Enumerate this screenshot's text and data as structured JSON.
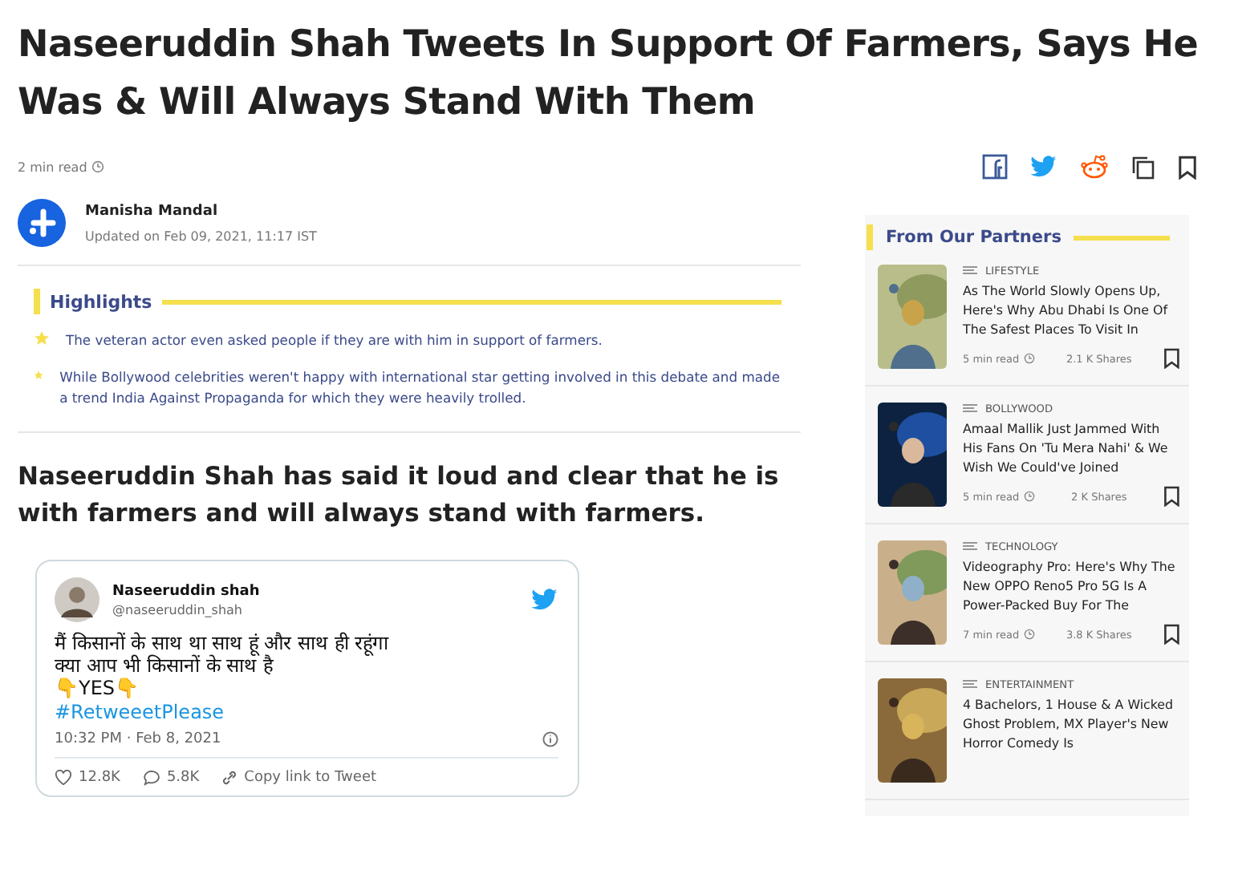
{
  "headline": "Naseeruddin Shah Tweets In Support Of Farmers, Says He Was & Will Always Stand With Them",
  "read_time": "2 min read",
  "share_icons": [
    {
      "kind": "facebook"
    },
    {
      "kind": "twitter"
    },
    {
      "kind": "reddit"
    },
    {
      "kind": "copy"
    },
    {
      "kind": "bookmark"
    }
  ],
  "author": {
    "name": "Manisha Mandal",
    "updated": "Updated on Feb 09, 2021, 11:17 IST"
  },
  "highlights": {
    "title": "Highlights",
    "items": [
      "The veteran actor even asked people if they are with him in support of farmers.",
      "While Bollywood celebrities weren't happy with international star getting involved in this debate and made a trend India Against Propaganda for which they were heavily trolled."
    ]
  },
  "subheading": "Naseeruddin Shah has said it loud and clear that he is with farmers and will always stand with farmers.",
  "tweet": {
    "name": "Naseeruddin shah",
    "handle": "@naseeruddin_shah",
    "lines": [
      "मैं किसानों के साथ था साथ हूं और साथ ही रहूंगा",
      "क्या आप भी किसानों के साथ है",
      "👇YES👇"
    ],
    "hashtag": "#RetweeetPlease",
    "time": "10:32 PM · Feb 8, 2021",
    "likes": "12.8K",
    "replies": "5.8K",
    "copy_link": "Copy link to Tweet"
  },
  "partners": {
    "title": "From Our Partners",
    "cards": [
      {
        "category": "LIFESTYLE",
        "title": "As The World Slowly Opens Up, Here's Why Abu Dhabi Is One Of The Safest Places To Visit In",
        "read": "5 min read",
        "shares": "2.1 K Shares",
        "kind": "picture"
      },
      {
        "category": "BOLLYWOOD",
        "title": "Amaal Mallik Just Jammed With His Fans On 'Tu Mera Nahi' & We Wish We Could've Joined",
        "read": "5 min read",
        "shares": "2 K Shares",
        "kind": "picture"
      },
      {
        "category": "TECHNOLOGY",
        "title": "Videography Pro: Here's Why The New OPPO Reno5 Pro 5G Is A Power-Packed Buy For The",
        "read": "7 min read",
        "shares": "3.8 K Shares",
        "kind": "picture"
      },
      {
        "category": "ENTERTAINMENT",
        "title": "4 Bachelors, 1 House & A Wicked Ghost Problem, MX Player's New Horror Comedy Is",
        "kind": "picture"
      }
    ]
  }
}
